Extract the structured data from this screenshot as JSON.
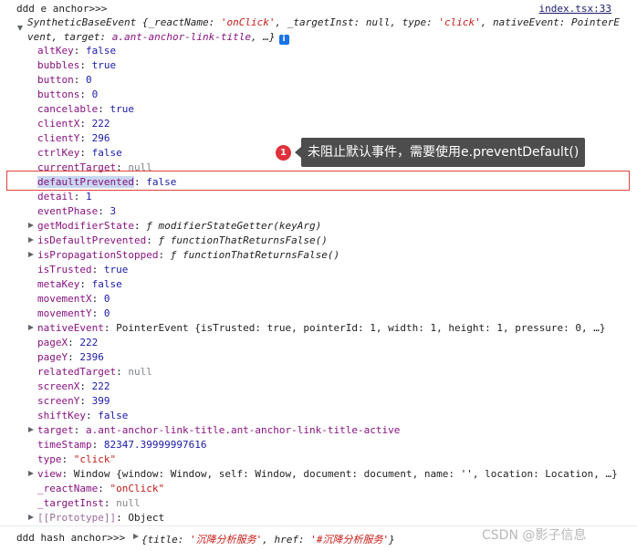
{
  "log": {
    "label": "ddd e anchor>>>",
    "source": "index.tsx:33",
    "summary_prefix": "SyntheticBaseEvent {_reactName: ",
    "summary_react_name": "'onClick'",
    "summary_mid1": ", _targetInst: null, type: ",
    "summary_type": "'click'",
    "summary_mid2": ", nativeEvent: PointerEvent, target: ",
    "summary_target": "a.ant-anchor-link-title",
    "summary_suffix": ", …}",
    "info_icon": "i"
  },
  "props": [
    {
      "key": "altKey",
      "value": "false",
      "kind": "bool",
      "expandable": false
    },
    {
      "key": "bubbles",
      "value": "true",
      "kind": "bool",
      "expandable": false
    },
    {
      "key": "button",
      "value": "0",
      "kind": "num",
      "expandable": false
    },
    {
      "key": "buttons",
      "value": "0",
      "kind": "num",
      "expandable": false
    },
    {
      "key": "cancelable",
      "value": "true",
      "kind": "bool",
      "expandable": false
    },
    {
      "key": "clientX",
      "value": "222",
      "kind": "num",
      "expandable": false
    },
    {
      "key": "clientY",
      "value": "296",
      "kind": "num",
      "expandable": false
    },
    {
      "key": "ctrlKey",
      "value": "false",
      "kind": "bool",
      "expandable": false
    },
    {
      "key": "currentTarget",
      "value": "null",
      "kind": "null",
      "expandable": false
    },
    {
      "key": "defaultPrevented",
      "value": "false",
      "kind": "bool",
      "expandable": false,
      "selected": true
    },
    {
      "key": "detail",
      "value": "1",
      "kind": "num",
      "expandable": false
    },
    {
      "key": "eventPhase",
      "value": "3",
      "kind": "num",
      "expandable": false
    },
    {
      "key": "getModifierState",
      "value": "ƒ modifierStateGetter(keyArg)",
      "kind": "fn",
      "expandable": true
    },
    {
      "key": "isDefaultPrevented",
      "value": "ƒ functionThatReturnsFalse()",
      "kind": "fn",
      "expandable": true
    },
    {
      "key": "isPropagationStopped",
      "value": "ƒ functionThatReturnsFalse()",
      "kind": "fn",
      "expandable": true
    },
    {
      "key": "isTrusted",
      "value": "true",
      "kind": "bool",
      "expandable": false
    },
    {
      "key": "metaKey",
      "value": "false",
      "kind": "bool",
      "expandable": false
    },
    {
      "key": "movementX",
      "value": "0",
      "kind": "num",
      "expandable": false
    },
    {
      "key": "movementY",
      "value": "0",
      "kind": "num",
      "expandable": false
    },
    {
      "key": "nativeEvent",
      "value": "PointerEvent {isTrusted: true, pointerId: 1, width: 1, height: 1, pressure: 0, …}",
      "kind": "obj",
      "expandable": true
    },
    {
      "key": "pageX",
      "value": "222",
      "kind": "num",
      "expandable": false
    },
    {
      "key": "pageY",
      "value": "2396",
      "kind": "num",
      "expandable": false
    },
    {
      "key": "relatedTarget",
      "value": "null",
      "kind": "null",
      "expandable": false
    },
    {
      "key": "screenX",
      "value": "222",
      "kind": "num",
      "expandable": false
    },
    {
      "key": "screenY",
      "value": "399",
      "kind": "num",
      "expandable": false
    },
    {
      "key": "shiftKey",
      "value": "false",
      "kind": "bool",
      "expandable": false
    },
    {
      "key": "target",
      "value": "a.ant-anchor-link-title.ant-anchor-link-title-active",
      "kind": "tgt",
      "expandable": true
    },
    {
      "key": "timeStamp",
      "value": "82347.39999997616",
      "kind": "num",
      "expandable": false
    },
    {
      "key": "type",
      "value": "\"click\"",
      "kind": "str",
      "expandable": false
    },
    {
      "key": "view",
      "value": "Window {window: Window, self: Window, document: document, name: '', location: Location, …}",
      "kind": "obj",
      "expandable": true
    },
    {
      "key": "_reactName",
      "value": "\"onClick\"",
      "kind": "str",
      "expandable": false
    },
    {
      "key": "_targetInst",
      "value": "null",
      "kind": "null",
      "expandable": false
    },
    {
      "key": "[[Prototype]]",
      "value": "Object",
      "kind": "obj",
      "expandable": true,
      "dim": true
    }
  ],
  "callout": {
    "number": "1",
    "text": "未阻止默认事件，需要使用e.preventDefault()"
  },
  "hash_log": {
    "label": "ddd hash anchor>>>",
    "prefix": "{title: ",
    "title_value": "'沉降分析服务'",
    "mid": ", href: ",
    "href_value": "'#沉降分析服务'",
    "suffix": "}"
  },
  "watermark": "CSDN @影子信息",
  "colors": {
    "highlight_border": "#e0443a",
    "callout_badge": "#e0303a",
    "callout_bg": "#4d4d4d",
    "key_purple": "#881280",
    "value_blue": "#1a1aa6",
    "string_red": "#c41a16"
  }
}
